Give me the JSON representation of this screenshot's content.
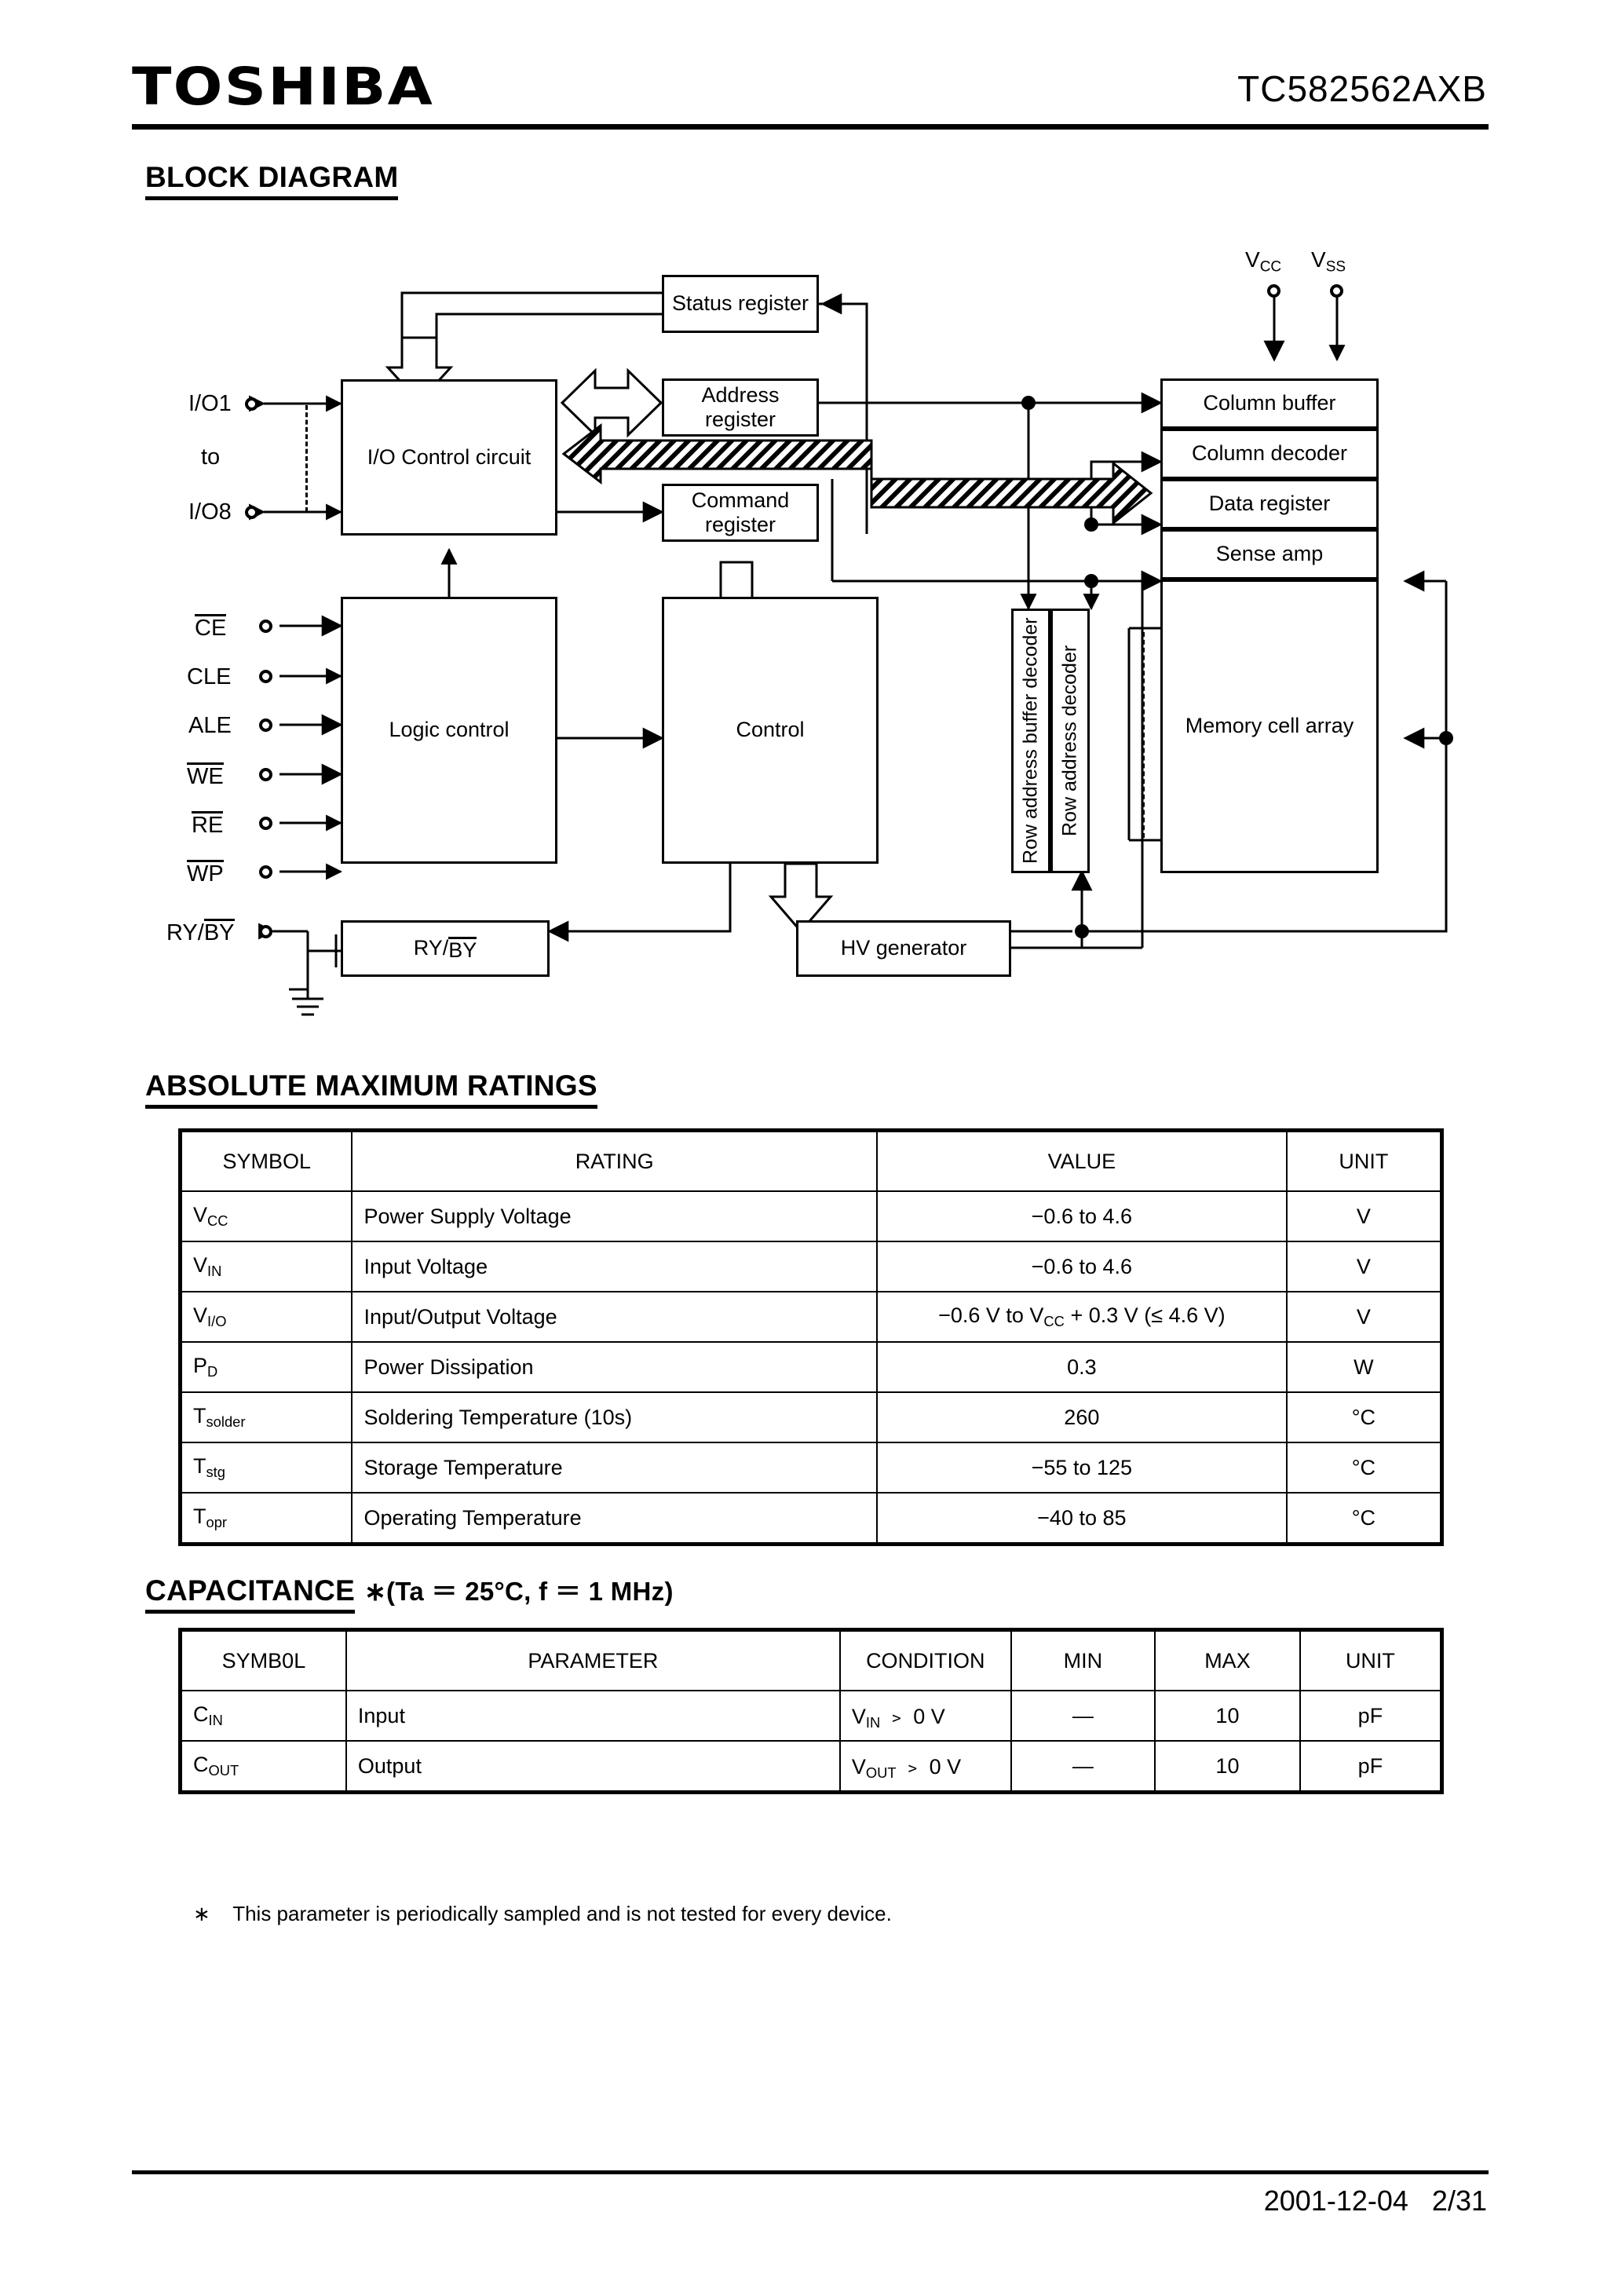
{
  "header": {
    "brand": "TOSHIBA",
    "part_number": "TC582562AXB"
  },
  "sections": {
    "block_diagram_title": "BLOCK DIAGRAM",
    "abs_max_title": "ABSOLUTE MAXIMUM RATINGS",
    "capacitance_title": "CAPACITANCE",
    "capacitance_cond": "∗(Ta ＝ 25°C, f ＝ 1 MHz)"
  },
  "block_diagram": {
    "blocks": {
      "status_register": "Status register",
      "address_register": "Address register",
      "command_register": "Command register",
      "io_control_circuit": "I/O Control circuit",
      "logic_control": "Logic control",
      "control": "Control",
      "ry_by": "RY/BY",
      "hv_generator": "HV generator",
      "column_buffer": "Column buffer",
      "column_decoder": "Column decoder",
      "data_register": "Data register",
      "sense_amp": "Sense amp",
      "row_address_buffer_decoder": "Row address buffer decoder",
      "row_address_decoder": "Row address decoder",
      "memory_cell_array": "Memory cell array"
    },
    "pins": {
      "io_first": "I/O1",
      "io_to": "to",
      "io_last": "I/O8",
      "ce": "CE",
      "cle": "CLE",
      "ale": "ALE",
      "we": "WE",
      "re": "RE",
      "wp": "WP",
      "ry_by": "RY/BY",
      "vcc": "VCC",
      "vss": "VSS"
    }
  },
  "abs_max_table": {
    "columns": [
      "SYMBOL",
      "RATING",
      "VALUE",
      "UNIT"
    ],
    "rows": [
      {
        "symbol": "VCC",
        "symbol_base": "V",
        "symbol_sub": "CC",
        "rating": "Power Supply Voltage",
        "value": "−0.6 to 4.6",
        "unit": "V"
      },
      {
        "symbol": "VIN",
        "symbol_base": "V",
        "symbol_sub": "IN",
        "rating": "Input Voltage",
        "value": "−0.6 to 4.6",
        "unit": "V"
      },
      {
        "symbol": "VI/O",
        "symbol_base": "V",
        "symbol_sub": "I/O",
        "rating": "Input/Output Voltage",
        "value": "−0.6 V to VCC + 0.3 V (≤ 4.6 V)",
        "unit": "V"
      },
      {
        "symbol": "PD",
        "symbol_base": "P",
        "symbol_sub": "D",
        "rating": "Power Dissipation",
        "value": "0.3",
        "unit": "W"
      },
      {
        "symbol": "Tsolder",
        "symbol_base": "T",
        "symbol_sub": "solder",
        "rating": "Soldering Temperature (10s)",
        "value": "260",
        "unit": "°C"
      },
      {
        "symbol": "Tstg",
        "symbol_base": "T",
        "symbol_sub": "stg",
        "rating": "Storage Temperature",
        "value": "−55 to 125",
        "unit": "°C"
      },
      {
        "symbol": "Topr",
        "symbol_base": "T",
        "symbol_sub": "opr",
        "rating": "Operating Temperature",
        "value": "−40 to 85",
        "unit": "°C"
      }
    ]
  },
  "capacitance_table": {
    "columns": [
      "SYMB0L",
      "PARAMETER",
      "CONDITION",
      "MIN",
      "MAX",
      "UNIT"
    ],
    "rows": [
      {
        "symbol_base": "C",
        "symbol_sub": "IN",
        "parameter": "Input",
        "cond_base": "V",
        "cond_sub": "IN",
        "cond_tail": " ＝ 0 V",
        "min": "—",
        "max": "10",
        "unit": "pF"
      },
      {
        "symbol_base": "C",
        "symbol_sub": "OUT",
        "parameter": "Output",
        "cond_base": "V",
        "cond_sub": "OUT",
        "cond_tail": " ＝ 0 V",
        "min": "—",
        "max": "10",
        "unit": "pF"
      }
    ]
  },
  "footnote": "∗    This parameter is periodically sampled and is not tested for every device.",
  "footer": {
    "date": "2001-12-04",
    "page": "2/31"
  }
}
